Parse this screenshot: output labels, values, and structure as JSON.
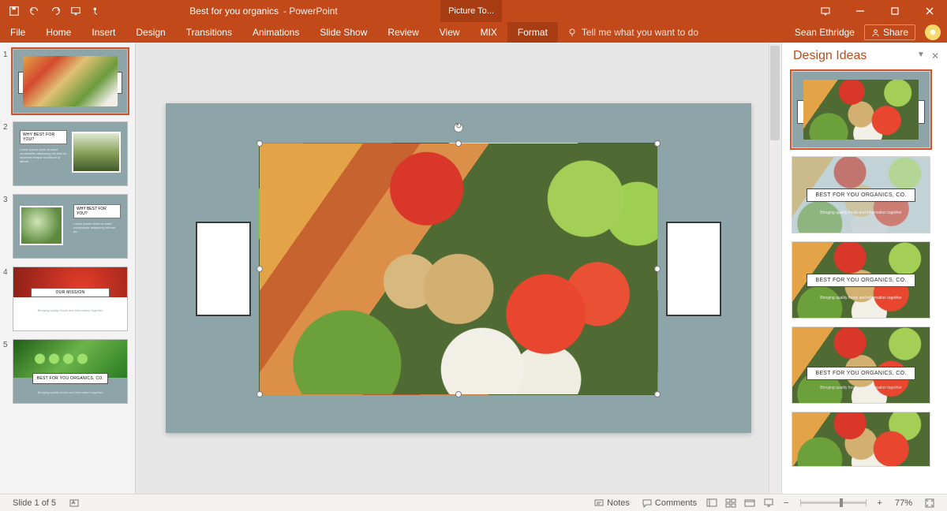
{
  "titlebar": {
    "document": "Best for you organics",
    "app": "PowerPoint",
    "context_tab": "Picture To..."
  },
  "ribbon": {
    "tabs": [
      "File",
      "Home",
      "Insert",
      "Design",
      "Transitions",
      "Animations",
      "Slide Show",
      "Review",
      "View",
      "MIX",
      "Format"
    ],
    "active_tab": "Format",
    "tellme_placeholder": "Tell me what you want to do",
    "user_name": "Sean Ethridge",
    "share_label": "Share"
  },
  "thumbnails": {
    "items": [
      {
        "num": "1"
      },
      {
        "num": "2",
        "heading": "WHY BEST FOR YOU?",
        "body": "Lorem ipsum dolor sit amet consectetur adipiscing elit sed do eiusmod tempor incididunt ut labore."
      },
      {
        "num": "3",
        "heading": "WHY BEST FOR YOU?",
        "body": "Lorem ipsum dolor sit amet consectetur adipiscing elit sed do."
      },
      {
        "num": "4",
        "heading": "OUR MISSION",
        "sub": "Bringing quality foods and information together"
      },
      {
        "num": "5",
        "heading": "BEST FOR YOU ORGANICS, CO.",
        "sub": "Bringing quality foods and information together"
      }
    ]
  },
  "design_ideas": {
    "title": "Design Ideas",
    "card_title": "BEST FOR YOU ORGANICS, CO.",
    "card_sub": "Bringing quality foods and information together"
  },
  "statusbar": {
    "slide_indicator": "Slide 1 of 5",
    "notes": "Notes",
    "comments": "Comments",
    "zoom_pct": "77%"
  }
}
